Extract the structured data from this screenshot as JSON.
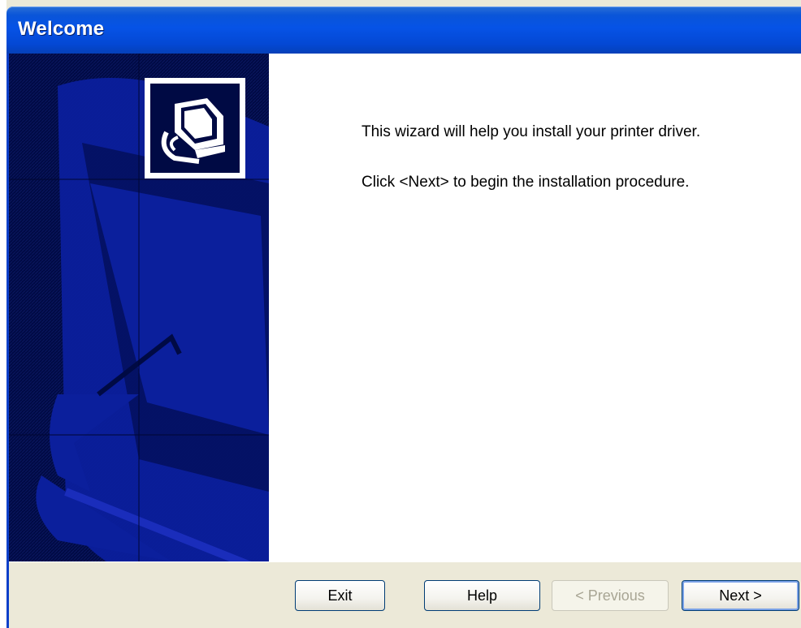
{
  "window": {
    "title": "Welcome"
  },
  "content": {
    "line1": "This wizard will help you install your printer driver.",
    "line2": "Click <Next> to begin the installation procedure."
  },
  "buttons": {
    "exit": "Exit",
    "help": "Help",
    "previous": "< Previous",
    "next": "Next >"
  },
  "colors": {
    "titlebar": "#0653e6",
    "side_panel": "#000a44",
    "accent_shape": "#0b1f9c",
    "button_bar": "#ece9d8"
  },
  "icons": {
    "wizard_icon": "printer-setup-icon"
  }
}
